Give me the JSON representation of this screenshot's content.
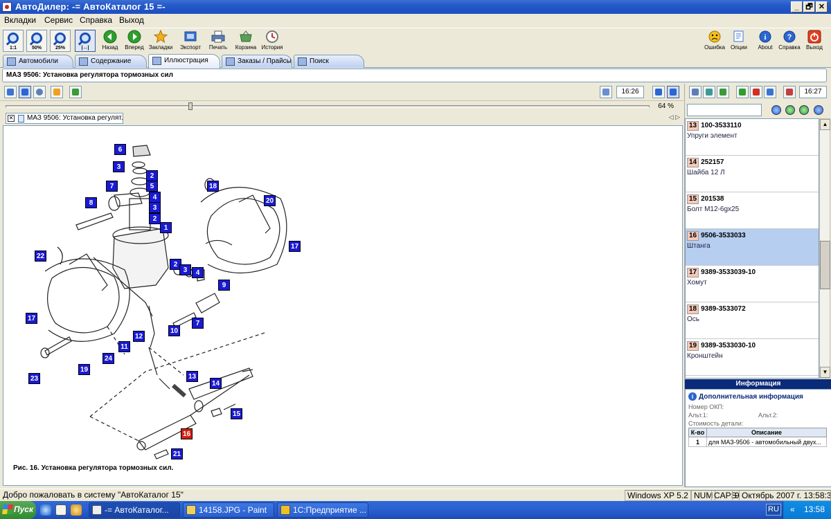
{
  "window": {
    "title": "АвтоДилер: -= АвтоКаталог 15 =-",
    "controls": [
      "_",
      "🗗",
      "✕"
    ]
  },
  "menu": [
    "Вкладки",
    "Сервис",
    "Справка",
    "Выход"
  ],
  "toolbar": {
    "zoom": [
      "1:1",
      "50%",
      "25%",
      ""
    ],
    "buttons": [
      {
        "label": "Назад",
        "icon": "back-arrow-icon",
        "color": "#2e9e2e"
      },
      {
        "label": "Вперед",
        "icon": "forward-arrow-icon",
        "color": "#2e9e2e"
      },
      {
        "label": "Закладки",
        "icon": "star-icon",
        "color": "#f0b020"
      },
      {
        "label": "Экспорт",
        "icon": "export-icon",
        "color": "#3a74d0"
      },
      {
        "label": "Печать",
        "icon": "printer-icon",
        "color": "#5a7fb8"
      },
      {
        "label": "Корзина",
        "icon": "basket-icon",
        "color": "#5aa05a"
      },
      {
        "label": "История",
        "icon": "history-icon",
        "color": "#7a7a7a"
      }
    ],
    "right_buttons": [
      {
        "label": "Ошибка",
        "icon": "error-face-icon",
        "color": "#f0c020"
      },
      {
        "label": "Опции",
        "icon": "options-icon",
        "color": "#3a74d0"
      },
      {
        "label": "About",
        "icon": "info-icon",
        "color": "#2b66d1"
      },
      {
        "label": "Справка",
        "icon": "help-icon",
        "color": "#2b66d1"
      },
      {
        "label": "Выход",
        "icon": "power-icon",
        "color": "#e04020"
      }
    ]
  },
  "tabs": [
    "Автомобили",
    "Содержание",
    "Иллюстрация",
    "Заказы / Прайсы",
    "Поиск"
  ],
  "active_tab": "Иллюстрация",
  "breadcrumb": "МАЗ 9506: Установка регулятора тормозных сил",
  "illustration": {
    "time_left": "16:26",
    "zoom_percent": "64 %",
    "zoom_level": 0.27,
    "doc_tab": "МАЗ 9506: Установка регулят...",
    "nav_arrows": "◁ ▷",
    "caption": "Рис. 16. Установка регулятора тормозных сил.",
    "callouts": [
      "6",
      "3",
      "2",
      "5",
      "7",
      "4",
      "8",
      "3",
      "2",
      "1",
      "18",
      "20",
      "17",
      "22",
      "2",
      "3",
      "4",
      "9",
      "17",
      "7",
      "10",
      "12",
      "11",
      "24",
      "19",
      "23",
      "13",
      "14",
      "15",
      "16",
      "21"
    ]
  },
  "right_panel": {
    "time": "16:27",
    "search_value": "",
    "parts": [
      {
        "num": "13",
        "code": "100-3533110",
        "desc": "Упруги элемент",
        "selected": false
      },
      {
        "num": "14",
        "code": "252157",
        "desc": "Шайба 12 Л",
        "selected": false
      },
      {
        "num": "15",
        "code": "201538",
        "desc": "Болт М12-6gx25",
        "selected": false
      },
      {
        "num": "16",
        "code": "9506-3533033",
        "desc": "Штанга",
        "selected": true
      },
      {
        "num": "17",
        "code": "9389-3533039-10",
        "desc": "Хомут",
        "selected": false
      },
      {
        "num": "18",
        "code": "9389-3533072",
        "desc": "Ось",
        "selected": false
      },
      {
        "num": "19",
        "code": "9389-3533030-10",
        "desc": "Кронштейн",
        "selected": false
      }
    ],
    "info": {
      "header": "Информация",
      "title": "Дополнительная информация",
      "okp_label": "Номер ОКП:",
      "alt1_label": "Альт.1:",
      "alt2_label": "Альт.2:",
      "cost_label": "Стоимость детали:",
      "table_headers": [
        "К-во",
        "Описание"
      ],
      "rows": [
        {
          "qty": "1",
          "desc": "для МАЗ-9506 - автомобильный двух..."
        }
      ]
    }
  },
  "statusbar": {
    "message": "Добро пожаловать в систему \"АвтоКаталог 15\"",
    "os": "Windows XP 5.2",
    "num": "NUM",
    "caps": "CAPS",
    "date": "9 Октябрь 2007 г. 13:58:3"
  },
  "taskbar": {
    "start": "Пуск",
    "items": [
      "-= АвтоКаталог...",
      "14158.JPG - Paint",
      "1С:Предприятие ..."
    ],
    "lang": "RU",
    "chevron": "«",
    "clock": "13:58"
  }
}
